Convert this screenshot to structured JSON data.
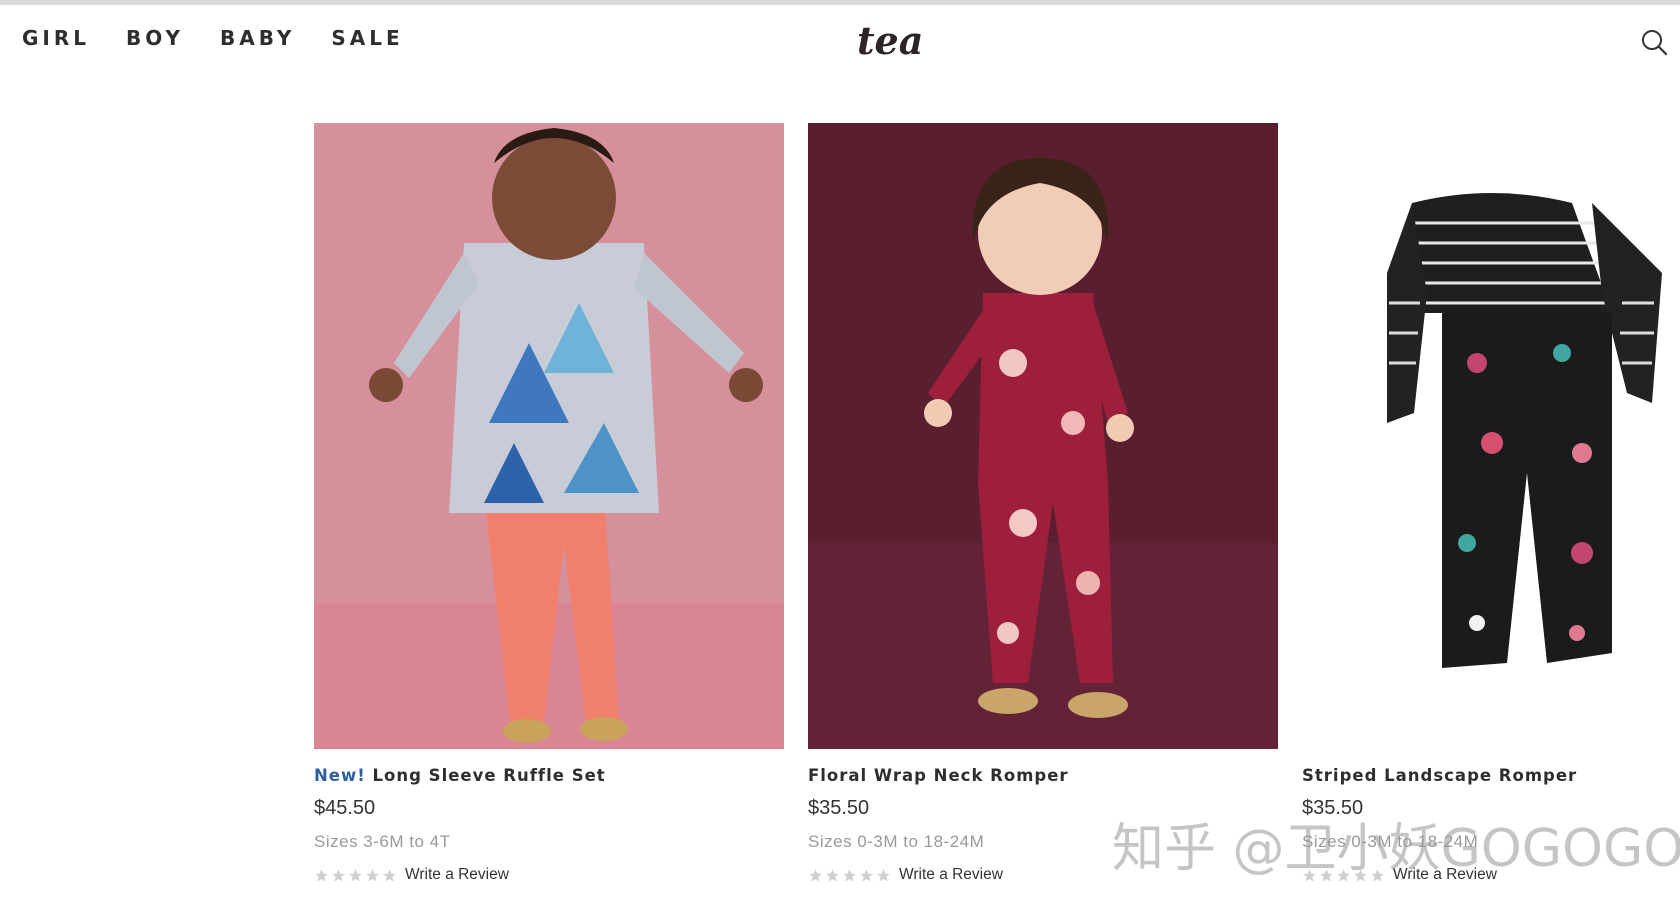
{
  "nav": {
    "items": [
      "GIRL",
      "BOY",
      "BABY",
      "SALE"
    ],
    "logo_text": "tea",
    "search_icon": "search-icon"
  },
  "products": [
    {
      "badge": "New!",
      "name": "Long Sleeve Ruffle Set",
      "price": "$45.50",
      "sizes": "Sizes 3-6M to 4T",
      "review_label": "Write a Review",
      "rating": 0
    },
    {
      "badge": "",
      "name": "Floral Wrap Neck Romper",
      "price": "$35.50",
      "sizes": "Sizes 0-3M to 18-24M",
      "review_label": "Write a Review",
      "rating": 0
    },
    {
      "badge": "",
      "name": "Striped Landscape Romper",
      "price": "$35.50",
      "sizes": "Sizes 0-3M to 18-24M",
      "review_label": "Write a Review",
      "rating": 0
    }
  ],
  "watermark": "知乎 @卫小妖GOGOGO",
  "colors": {
    "badge": "#2f5fa0",
    "card1_bg": "#d88c98",
    "card2_bg": "#5e1e30",
    "star_empty": "#d0d0d0"
  }
}
